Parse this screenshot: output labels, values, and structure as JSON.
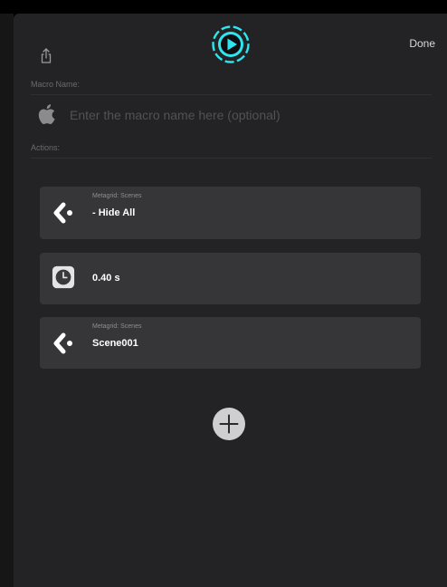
{
  "header": {
    "share_icon": "share-icon",
    "play_icon": "play-circle-icon",
    "play_accent": "#2ee6ee",
    "done_label": "Done"
  },
  "macro_name": {
    "label": "Macro Name:",
    "icon": "apple-logo-icon",
    "value": "",
    "placeholder": "Enter the macro name here (optional)"
  },
  "actions": {
    "label": "Actions:",
    "items": [
      {
        "icon": "metagrid-icon",
        "subtitle": "Metagrid: Scenes",
        "title": "- Hide All"
      },
      {
        "icon": "clock-icon",
        "subtitle": "",
        "title": "0.40 s"
      },
      {
        "icon": "metagrid-icon",
        "subtitle": "Metagrid: Scenes",
        "title": "Scene001"
      }
    ]
  },
  "add_action": {
    "icon": "plus-circle-icon"
  }
}
